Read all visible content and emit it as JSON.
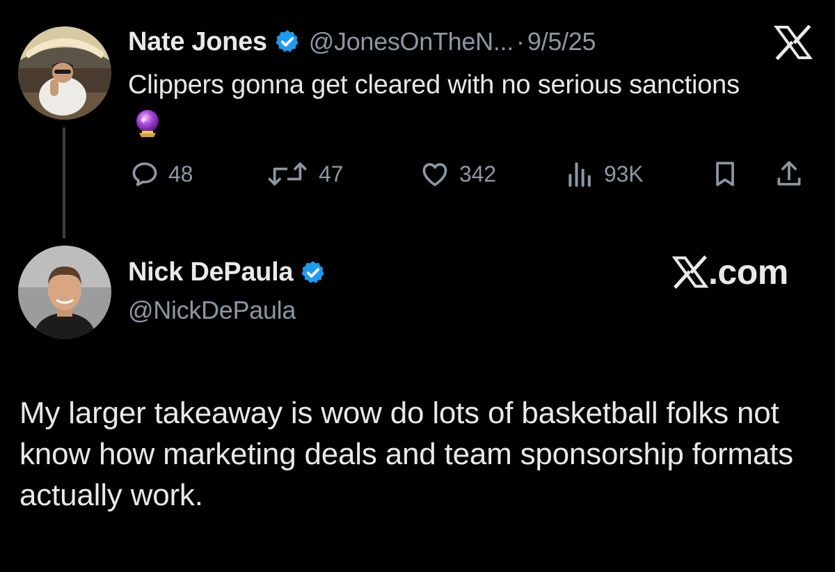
{
  "tweet1": {
    "author_name": "Nate Jones",
    "handle": "@JonesOnTheN...",
    "separator": "·",
    "date": "9/5/25",
    "text": "Clippers gonna get cleared with no serious sanctions",
    "emoji_icon": "crystal-ball-icon",
    "stats": {
      "replies": "48",
      "retweets": "47",
      "likes": "342",
      "views": "93K"
    }
  },
  "tweet2": {
    "author_name": "Nick DePaula",
    "handle": "@NickDePaula",
    "brand": ".com",
    "text": "My larger takeaway is wow do lots of basketball folks not know how marketing deals and team sponsorship formats actually work."
  },
  "icons": {
    "reply": "reply-icon",
    "retweet": "retweet-icon",
    "like": "heart-icon",
    "views": "views-icon",
    "bookmark": "bookmark-icon",
    "share": "share-icon",
    "verified": "verified-badge-icon",
    "logo": "x-logo-icon"
  },
  "colors": {
    "background": "#000000",
    "text": "#e7e9ea",
    "secondary": "#8b98a5",
    "verified": "#1d9bf0"
  }
}
